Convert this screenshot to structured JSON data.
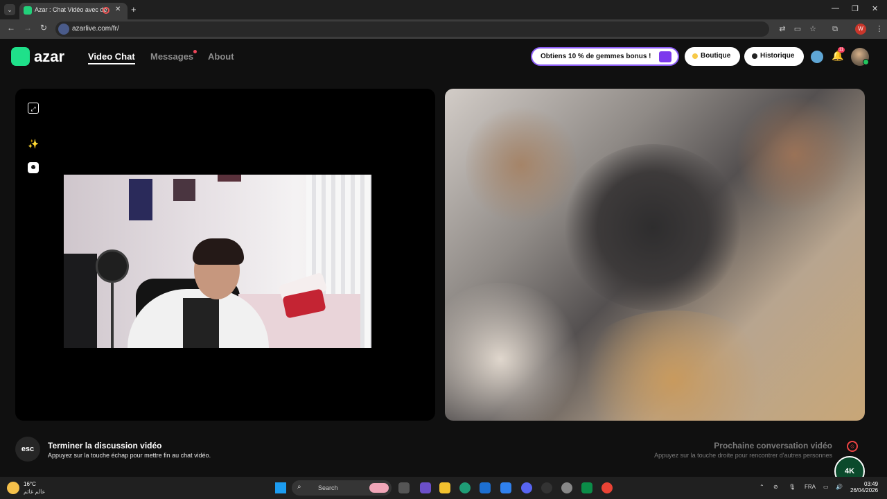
{
  "browser": {
    "tab_title": "Azar : Chat Vidéo avec de n",
    "url": "azarlive.com/fr/",
    "profile_letter": "W"
  },
  "app": {
    "logo": "azar",
    "nav": [
      {
        "label": "Video Chat"
      },
      {
        "label": "Messages"
      },
      {
        "label": "About"
      }
    ],
    "promo": "Obtiens 10 % de gemmes bonus !",
    "shop": "Boutique",
    "history": "Historique",
    "notif_badge": "11"
  },
  "footer": {
    "esc_key": "esc",
    "end_title": "Terminer la discussion vidéo",
    "end_sub": "Appuyez sur la touche échap pour mettre fin au chat vidéo.",
    "next_title": "Prochaine conversation vidéo",
    "next_sub": "Appuyez sur la touche droite pour rencontrer d'autres personnes"
  },
  "overlay": {
    "watermark": "4K"
  },
  "taskbar": {
    "temp": "16°C",
    "weather_sub": "عالم غائم",
    "search": "Search",
    "lang": "FRA",
    "time": "03:49",
    "date": "26/04/2026"
  },
  "colors": {
    "accent": "#1fe08a",
    "promo_border": "#8b5cf6",
    "alert": "#f43f5e"
  }
}
